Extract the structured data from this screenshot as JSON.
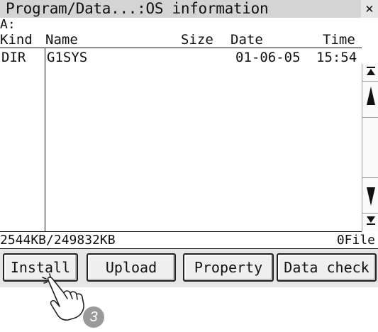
{
  "window": {
    "title": "Program/Data...:OS information",
    "close_glyph": "✕"
  },
  "drive": {
    "label": "A:"
  },
  "columns": {
    "kind": "Kind",
    "name": "Name",
    "size": "Size",
    "date": "Date",
    "time": "Time"
  },
  "rows": [
    {
      "kind": "DIR",
      "name": "G1SYS",
      "size": "",
      "date": "01-06-05",
      "time": "15:54"
    }
  ],
  "scrollbar": {
    "top_icon": "scroll-to-top-icon",
    "page_up_icon": "page-up-icon",
    "page_down_icon": "page-down-icon",
    "bottom_icon": "scroll-to-bottom-icon"
  },
  "status": {
    "capacity": "2544KB/249832KB",
    "file_count": "0File"
  },
  "buttons": {
    "install": "Install",
    "upload": "Upload",
    "property": "Property",
    "data_check": "Data check"
  },
  "callout": {
    "step_number": "3",
    "pointer_icon": "pointing-hand-icon"
  }
}
